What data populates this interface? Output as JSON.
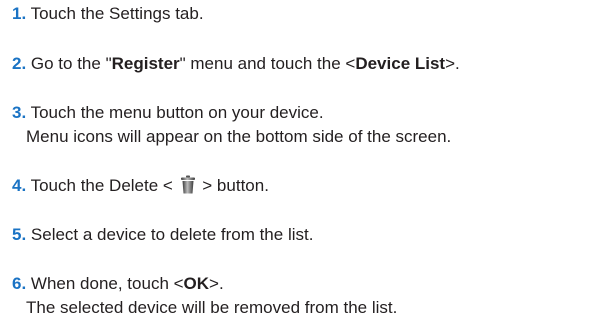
{
  "steps": [
    {
      "number": "1.",
      "text": " Touch the Settings tab."
    },
    {
      "number": "2.",
      "pre": " Go to the \"",
      "bold1": "Register",
      "mid": "\" menu and touch the <",
      "bold2": "Device List",
      "post": ">."
    },
    {
      "number": "3.",
      "text": " Touch the menu button on your device.",
      "line2": "Menu icons will appear on the bottom side of the screen."
    },
    {
      "number": "4.",
      "pre": " Touch the Delete < ",
      "icon": "trash-icon",
      "post": " > button."
    },
    {
      "number": "5.",
      "text": " Select a device to delete from the list."
    },
    {
      "number": "6.",
      "pre": " When done, touch <",
      "bold": "OK",
      "post": ">.",
      "line2": "The selected device will be removed from the list."
    }
  ],
  "colors": {
    "number": "#1a73c4",
    "text": "#231f20"
  }
}
